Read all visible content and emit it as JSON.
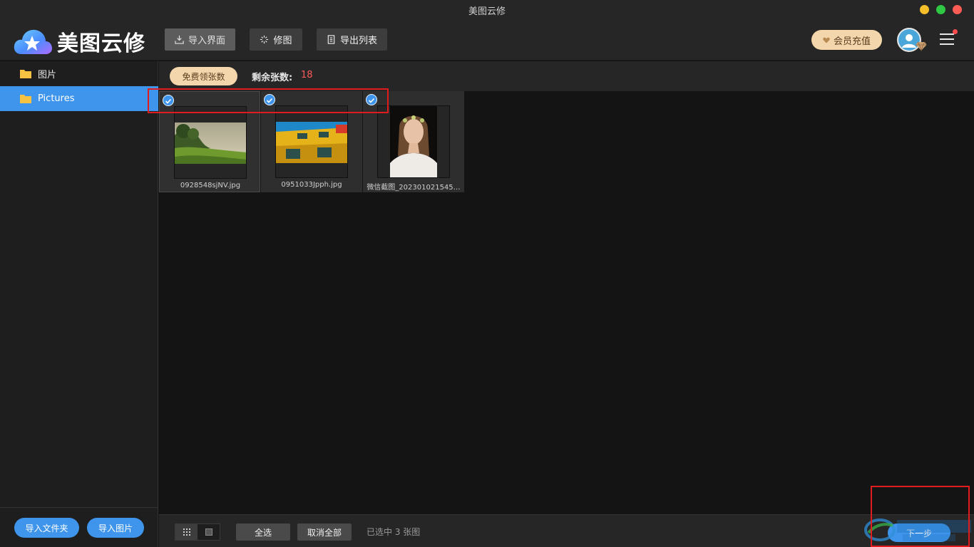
{
  "window": {
    "title": "美图云修",
    "controls": {
      "minimize_color": "#f5bf2a",
      "maximize_color": "#2ec845",
      "close_color": "#fd5c54"
    }
  },
  "header": {
    "brand": "美图云修",
    "toolbar": [
      {
        "label": "导入界面",
        "icon": "import-icon",
        "active": true
      },
      {
        "label": "修图",
        "icon": "sparkle-icon",
        "active": false
      },
      {
        "label": "导出列表",
        "icon": "list-doc-icon",
        "active": false
      }
    ],
    "vip_label": "会员充值",
    "has_notification": true
  },
  "sidebar": {
    "folders": [
      {
        "label": "图片",
        "selected": false
      },
      {
        "label": "Pictures",
        "selected": true
      }
    ],
    "import_folder_label": "导入文件夹",
    "import_images_label": "导入图片"
  },
  "subbar": {
    "free_button_label": "免费领张数",
    "remaining_label": "剩余张数:",
    "remaining_count": "18"
  },
  "images": [
    {
      "name": "0928548sjNV.jpg",
      "checked": true,
      "thumb": "landscape-forest"
    },
    {
      "name": "0951033Jpph.jpg",
      "checked": true,
      "thumb": "yellow-building"
    },
    {
      "name": "微信截图_202301021545…",
      "checked": true,
      "thumb": "portrait-woman"
    }
  ],
  "bottombar": {
    "select_all_label": "全选",
    "deselect_all_label": "取消全部",
    "selection_status": "已选中 3 张图",
    "next_label": "下一步",
    "view_mode": "grid"
  },
  "colors": {
    "accent": "#3f95ec",
    "gold": "#f3d6ab",
    "remaining_count": "#ff5a5a",
    "highlight": "#e01c1c"
  }
}
